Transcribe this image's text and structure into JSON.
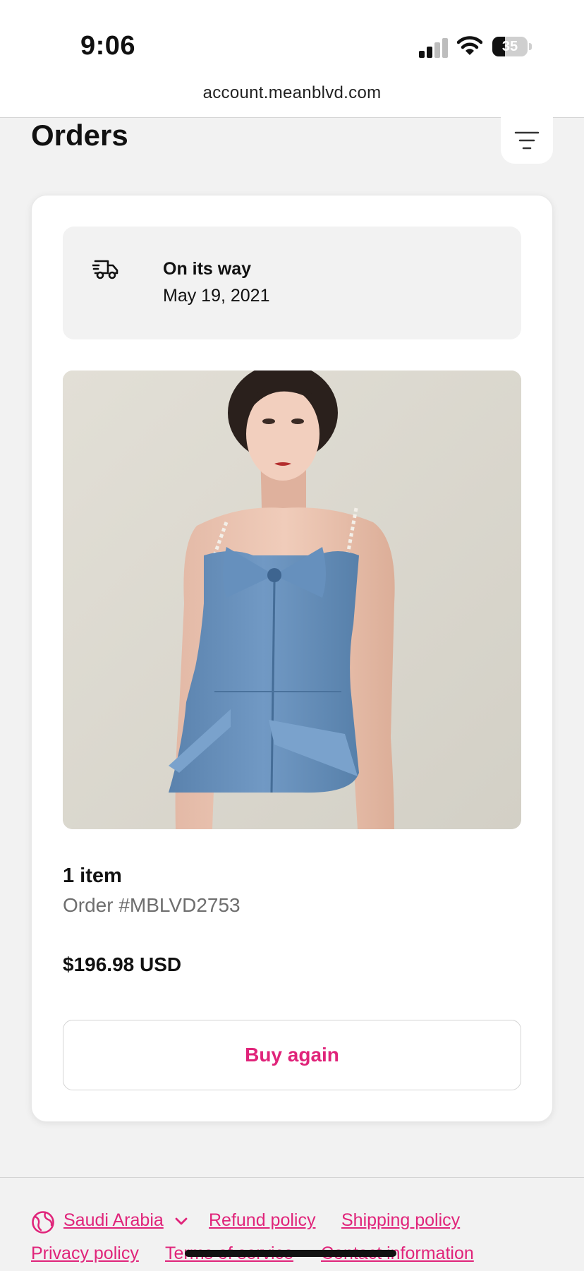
{
  "status_bar": {
    "time": "9:06",
    "battery_level": "35",
    "battery_fraction": 0.35
  },
  "browser": {
    "url": "account.meanblvd.com"
  },
  "header": {
    "title": "Orders",
    "filter_icon": "filter-icon"
  },
  "order": {
    "status": "On its way",
    "date": "May 19, 2021",
    "status_icon": "truck-icon",
    "item_count": "1 item",
    "order_number": "Order #MBLVD2753",
    "total": "$196.98 USD",
    "buy_again_label": "Buy again"
  },
  "footer": {
    "country": "Saudi Arabia",
    "links": [
      "Refund policy",
      "Shipping policy",
      "Privacy policy",
      "Terms of service",
      "Contact information"
    ]
  },
  "colors": {
    "accent": "#e0247a",
    "page_background": "#f2f2f2",
    "card_background": "#ffffff",
    "dress": "#6a93bf"
  }
}
